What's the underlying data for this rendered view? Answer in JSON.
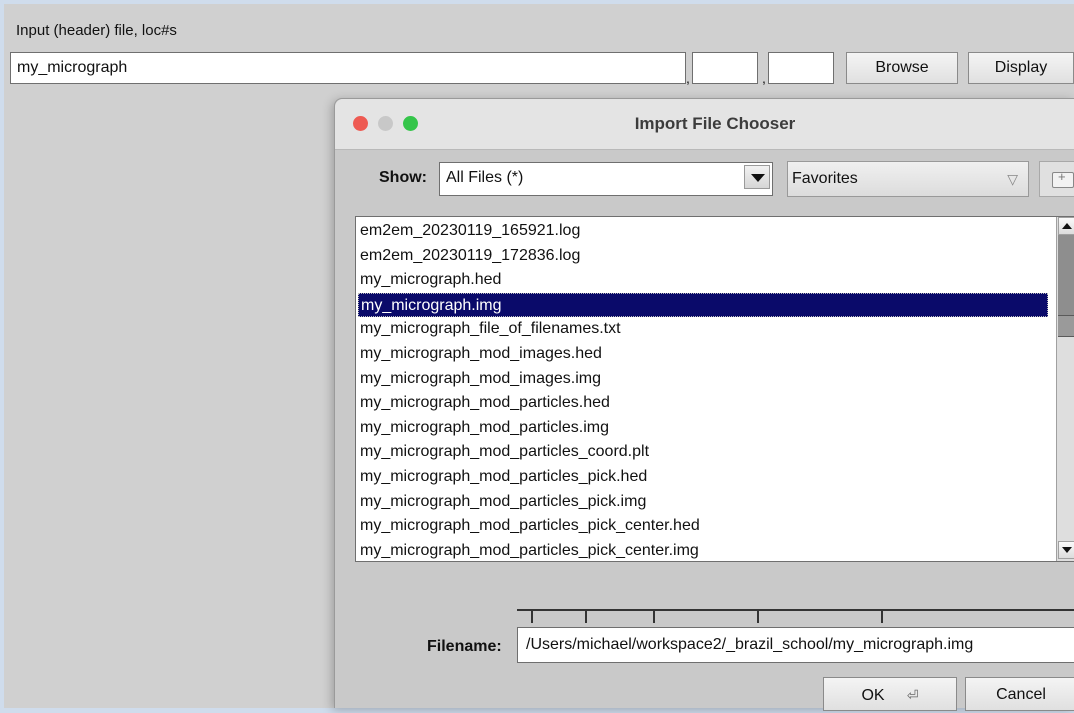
{
  "main": {
    "input_label": "Input (header) file, loc#s",
    "filename_value": "my_micrograph",
    "loc1_value": "",
    "loc2_value": "",
    "comma": ",",
    "browse_label": "Browse",
    "display_label": "Display"
  },
  "dialog": {
    "title": "Import File Chooser",
    "show_label": "Show:",
    "filter_value": "All Files (*)",
    "favorites_label": "Favorites",
    "favorites_arrow": "▽",
    "files": [
      "em2em_20230119_165921.log",
      "em2em_20230119_172836.log",
      "my_micrograph.hed",
      "my_micrograph.img",
      "my_micrograph_file_of_filenames.txt",
      "my_micrograph_mod_images.hed",
      "my_micrograph_mod_images.img",
      "my_micrograph_mod_particles.hed",
      "my_micrograph_mod_particles.img",
      "my_micrograph_mod_particles_coord.plt",
      "my_micrograph_mod_particles_pick.hed",
      "my_micrograph_mod_particles_pick.img",
      "my_micrograph_mod_particles_pick_center.hed",
      "my_micrograph_mod_particles_pick_center.img"
    ],
    "selected_index": 3,
    "filename_label": "Filename:",
    "filename_value": "/Users/michael/workspace2/_brazil_school/my_micrograph.img",
    "ok_label": "OK",
    "ok_icon": "⏎",
    "cancel_label": "Cancel"
  },
  "colors": {
    "selection": "#0a0a6a",
    "close": "#ee5a52",
    "minimize": "#c8c8c8",
    "zoom": "#35c54a"
  }
}
